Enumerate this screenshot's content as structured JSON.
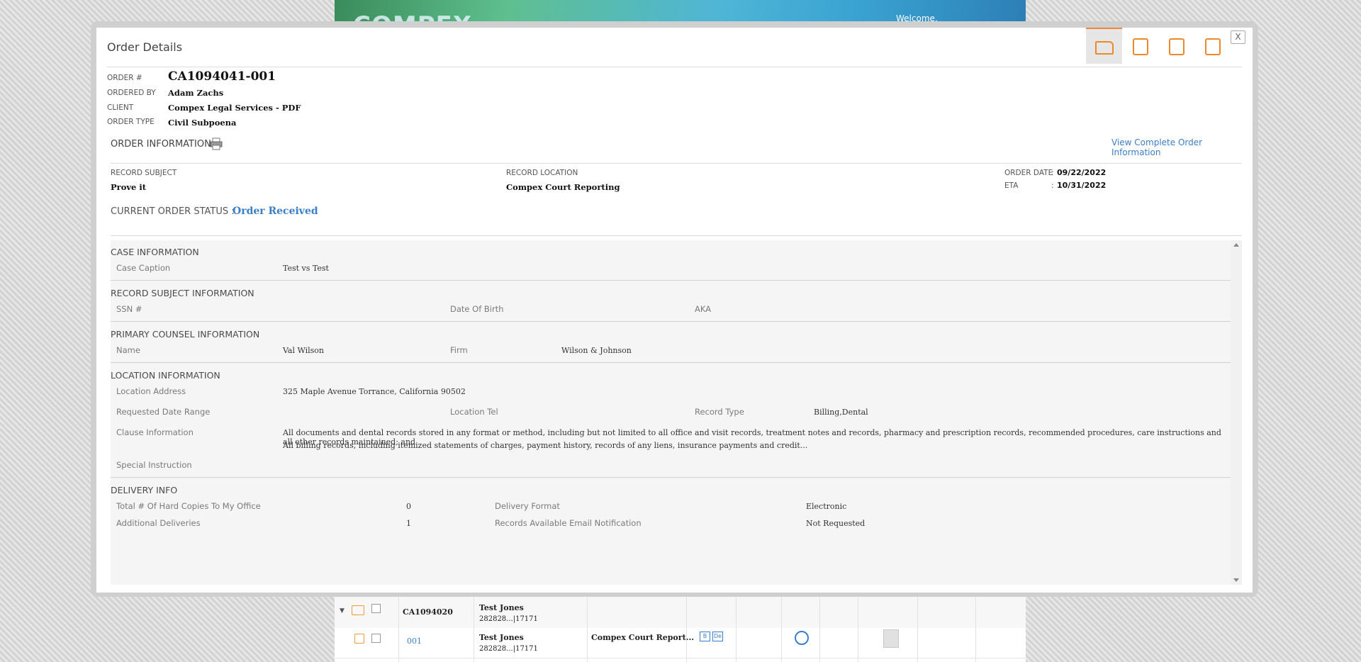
{
  "background": {
    "logo": "COMPEX",
    "welcome": "Welcome,",
    "rows": [
      {
        "order": "CA1094020",
        "name": "Test Jones",
        "sub": "282828...|17171",
        "sub2": "|17171",
        "top_partial": "282828...|17171  |17171"
      },
      {
        "suborder": "001",
        "name": "Test Jones",
        "sub": "282828...|17171",
        "sub2": "|17171",
        "location": "Compex Court Report...",
        "badge1": "B",
        "badge2": "De"
      }
    ]
  },
  "modal": {
    "title": "Order Details",
    "close_label": "X",
    "toolbar": [
      {
        "name": "folder-icon"
      },
      {
        "name": "document-search-icon"
      },
      {
        "name": "document-list-icon"
      },
      {
        "name": "documents-copy-icon"
      }
    ],
    "header": {
      "order_label": "ORDER #",
      "order_value": "CA1094041-001",
      "ordered_by_label": "ORDERED BY",
      "ordered_by_value": "Adam Zachs",
      "client_label": "CLIENT",
      "client_value": "Compex Legal Services - PDF",
      "order_type_label": "ORDER TYPE",
      "order_type_value": "Civil Subpoena"
    },
    "order_info": {
      "title": "ORDER INFORMATION",
      "view_link": "View Complete Order Information",
      "record_subject_label": "RECORD SUBJECT",
      "record_subject_value": "Prove it",
      "record_location_label": "RECORD LOCATION",
      "record_location_value": "Compex Court Reporting",
      "order_date_label": "ORDER DATE",
      "order_date_value": "09/22/2022",
      "eta_label": "ETA",
      "eta_value": "10/31/2022",
      "colon": ":"
    },
    "status": {
      "label": "CURRENT ORDER STATUS :",
      "value": "Order Received"
    },
    "case": {
      "title": "CASE INFORMATION",
      "caption_label": "Case Caption",
      "caption_value": "Test vs Test"
    },
    "subject": {
      "title": "RECORD SUBJECT INFORMATION",
      "ssn_label": "SSN #",
      "dob_label": "Date Of Birth",
      "aka_label": "AKA"
    },
    "counsel": {
      "title": "PRIMARY COUNSEL INFORMATION",
      "name_label": "Name",
      "name_value": "Val Wilson",
      "firm_label": "Firm",
      "firm_value": "Wilson & Johnson"
    },
    "location": {
      "title": "LOCATION INFORMATION",
      "address_label": "Location Address",
      "address_value": "325 Maple Avenue Torrance, California 90502",
      "date_range_label": "Requested Date Range",
      "tel_label": "Location Tel",
      "record_type_label": "Record Type",
      "record_type_value": "Billing,Dental",
      "clause_label": "Clause Information",
      "clause_line1": "All documents and dental records stored in any format or method, including but not limited to all office and visit records, treatment notes and records, pharmacy and prescription records, recommended procedures, care instructions and all other records maintained; and",
      "clause_line2": "All billing records, including itemized statements of charges, payment history, records of any liens, insurance payments and credit...",
      "special_label": "Special Instruction"
    },
    "delivery": {
      "title": "DELIVERY INFO",
      "hard_copies_label": "Total # Of Hard Copies To My Office",
      "hard_copies_value": "0",
      "format_label": "Delivery Format",
      "format_value": "Electronic",
      "additional_label": "Additional Deliveries",
      "additional_value": "1",
      "email_label": "Records Available Email Notification",
      "email_value": "Not Requested"
    }
  },
  "colors": {
    "accent": "#3b7ec8",
    "orange": "#ec8a2a"
  }
}
